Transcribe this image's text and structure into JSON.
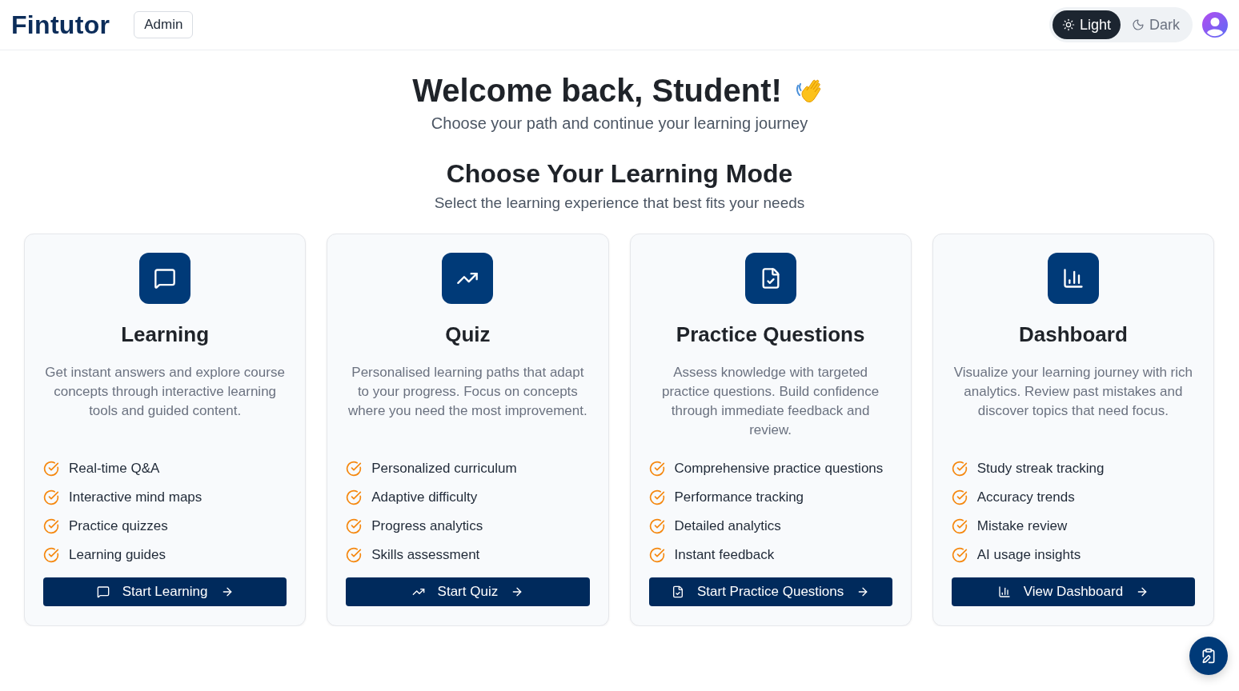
{
  "header": {
    "logo": "Fintutor",
    "admin_button": "Admin",
    "theme_toggle": [
      {
        "kind": "light",
        "label": "Light",
        "selected": true
      },
      {
        "kind": "dark",
        "label": "Dark",
        "selected": false
      }
    ]
  },
  "hero": {
    "title": "Welcome back, Student!",
    "subtitle": "Choose your path and continue your learning journey"
  },
  "modes_section": {
    "title": "Choose Your Learning Mode",
    "subtitle": "Select the learning experience that best fits your needs"
  },
  "cards": [
    {
      "kind": "learning",
      "title": "Learning",
      "description": "Get instant answers and explore course concepts through interactive learning tools and guided content.",
      "features": [
        "Real-time Q&A",
        "Interactive mind maps",
        "Practice quizzes",
        "Learning guides"
      ],
      "button": "Start Learning"
    },
    {
      "kind": "quiz",
      "title": "Quiz",
      "description": "Personalised learning paths that adapt to your progress. Focus on concepts where you need the most improvement.",
      "features": [
        "Personalized curriculum",
        "Adaptive difficulty",
        "Progress analytics",
        "Skills assessment"
      ],
      "button": "Start Quiz"
    },
    {
      "kind": "practice",
      "title": "Practice Questions",
      "description": "Assess knowledge with targeted practice questions. Build confidence through immediate feedback and review.",
      "features": [
        "Comprehensive practice questions",
        "Performance tracking",
        "Detailed analytics",
        "Instant feedback"
      ],
      "button": "Start Practice Questions"
    },
    {
      "kind": "dashboard",
      "title": "Dashboard",
      "description": "Visualize your learning journey with rich analytics. Review past mistakes and discover topics that need focus.",
      "features": [
        "Study streak tracking",
        "Accuracy trends",
        "Mistake review",
        "AI usage insights"
      ],
      "button": "View Dashboard"
    }
  ]
}
